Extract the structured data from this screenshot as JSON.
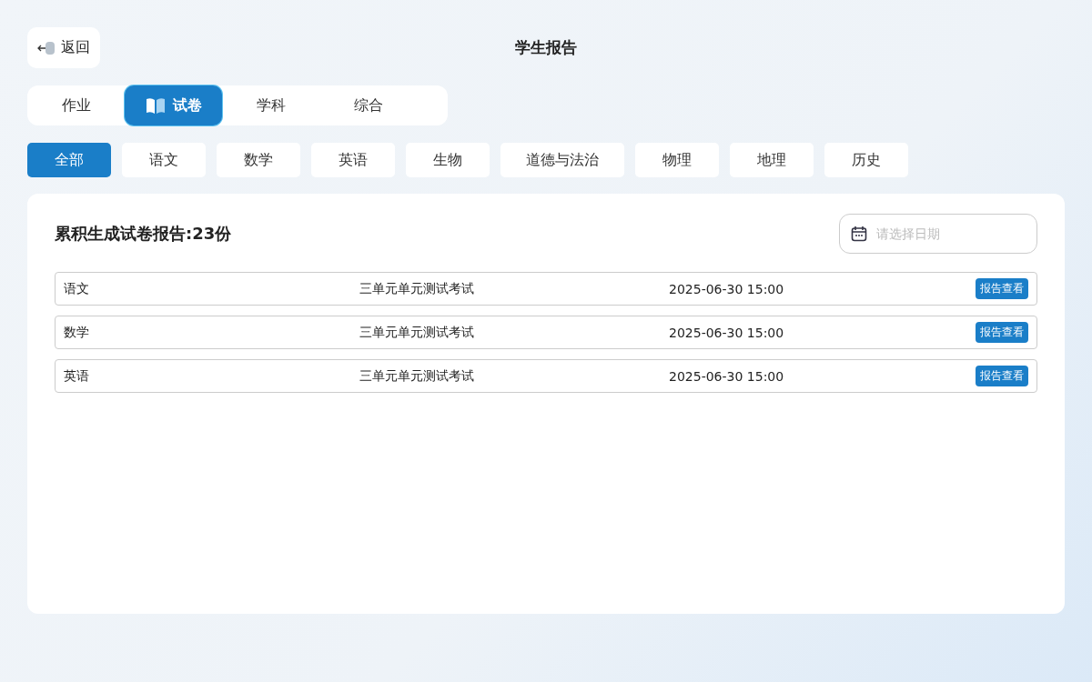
{
  "back_button": {
    "label": "返回"
  },
  "title": "学生报告",
  "tabs": [
    {
      "label": "作业",
      "selected": false
    },
    {
      "label": "试卷",
      "selected": true
    },
    {
      "label": "学科",
      "selected": false
    },
    {
      "label": "综合",
      "selected": false
    }
  ],
  "filters": [
    {
      "label": "全部",
      "selected": true
    },
    {
      "label": "语文",
      "selected": false
    },
    {
      "label": "数学",
      "selected": false
    },
    {
      "label": "英语",
      "selected": false
    },
    {
      "label": "生物",
      "selected": false
    },
    {
      "label": "道德与法治",
      "selected": false
    },
    {
      "label": "物理",
      "selected": false
    },
    {
      "label": "地理",
      "selected": false
    },
    {
      "label": "历史",
      "selected": false
    }
  ],
  "summary": "累积生成试卷报告:23份",
  "date_field": {
    "placeholder": "请选择日期"
  },
  "reports": [
    {
      "subject": "语文",
      "exam": "三单元单元测试考试",
      "time": "2025-06-30 15:00",
      "action": "报告查看"
    },
    {
      "subject": "数学",
      "exam": "三单元单元测试考试",
      "time": "2025-06-30 15:00",
      "action": "报告查看"
    },
    {
      "subject": "英语",
      "exam": "三单元单元测试考试",
      "time": "2025-06-30 15:00",
      "action": "报告查看"
    }
  ]
}
